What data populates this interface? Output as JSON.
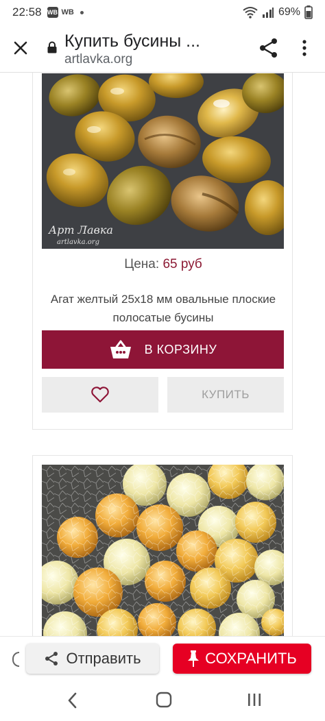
{
  "status_bar": {
    "time": "22:58",
    "notif_1": "WB",
    "notif_2": "WB",
    "battery": "69%"
  },
  "browser": {
    "title": "Купить бусины ...",
    "domain": "artlavka.org",
    "icons": [
      "close-icon",
      "lock-icon",
      "share-icon",
      "more-vert-icon"
    ]
  },
  "products": [
    {
      "watermark": "Арт Лавка",
      "watermark_sub": "artlavka.org",
      "price_label": "Цена: ",
      "price_value": "65 руб",
      "description": "Агат желтый 25х18 мм овальные плоские полосатые бусины",
      "cart_label": "В КОРЗИНУ",
      "buy_label": "КУПИТЬ"
    }
  ],
  "action_bar": {
    "send_label": "Отправить",
    "save_label": "СОХРАНИТЬ"
  },
  "colors": {
    "brand_maroon": "#8e1537",
    "price_color": "#8c1a34",
    "pinterest_red": "#e60023"
  }
}
